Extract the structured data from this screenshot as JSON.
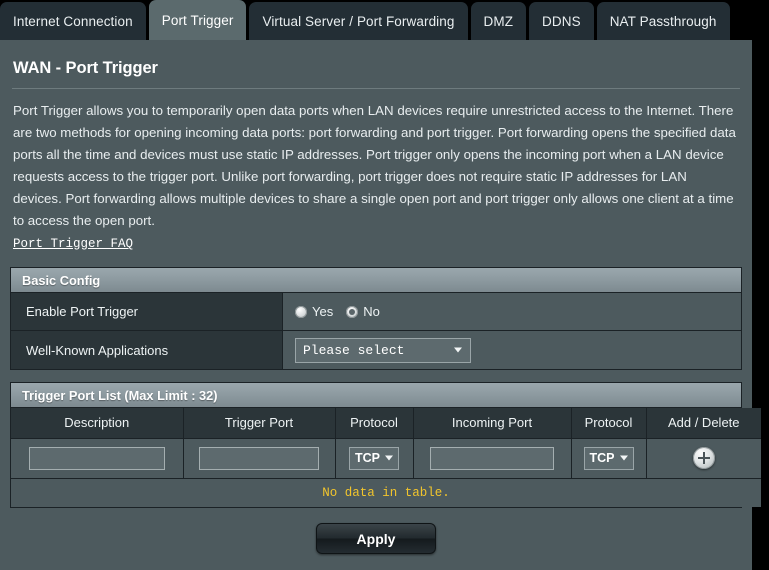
{
  "tabs": [
    {
      "label": "Internet Connection",
      "active": false
    },
    {
      "label": "Port Trigger",
      "active": true
    },
    {
      "label": "Virtual Server / Port Forwarding",
      "active": false
    },
    {
      "label": "DMZ",
      "active": false
    },
    {
      "label": "DDNS",
      "active": false
    },
    {
      "label": "NAT Passthrough",
      "active": false
    }
  ],
  "page": {
    "title": "WAN - Port Trigger",
    "description": "Port Trigger allows you to temporarily open data ports when LAN devices require unrestricted access to the Internet. There are two methods for opening incoming data ports: port forwarding and port trigger. Port forwarding opens the specified data ports all the time and devices must use static IP addresses. Port trigger only opens the incoming port when a LAN device requests access to the trigger port. Unlike port forwarding, port trigger does not require static IP addresses for LAN devices. Port forwarding allows multiple devices to share a single open port and port trigger only allows one client at a time to access the open port.",
    "faq_link": "Port Trigger FAQ"
  },
  "basic_config": {
    "header": "Basic Config",
    "enable_row": {
      "label": "Enable Port Trigger",
      "options": [
        {
          "label": "Yes",
          "selected": false
        },
        {
          "label": "No",
          "selected": true
        }
      ]
    },
    "apps_row": {
      "label": "Well-Known Applications",
      "select_value": "Please select"
    }
  },
  "trigger_list": {
    "header": "Trigger Port List (Max Limit : 32)",
    "columns": [
      "Description",
      "Trigger Port",
      "Protocol",
      "Incoming Port",
      "Protocol",
      "Add / Delete"
    ],
    "input_row": {
      "description_value": "",
      "trigger_port_value": "",
      "trigger_protocol": "TCP",
      "incoming_port_value": "",
      "incoming_protocol": "TCP",
      "add_icon": "plus-circle-icon"
    },
    "empty_message": "No data in table."
  },
  "footer": {
    "apply_label": "Apply"
  },
  "colors": {
    "body_bg": "#4d5a5e",
    "label_bg": "#2b3539",
    "accent_yellow": "#f2c52c",
    "tab_active": "#5b6a6d"
  }
}
